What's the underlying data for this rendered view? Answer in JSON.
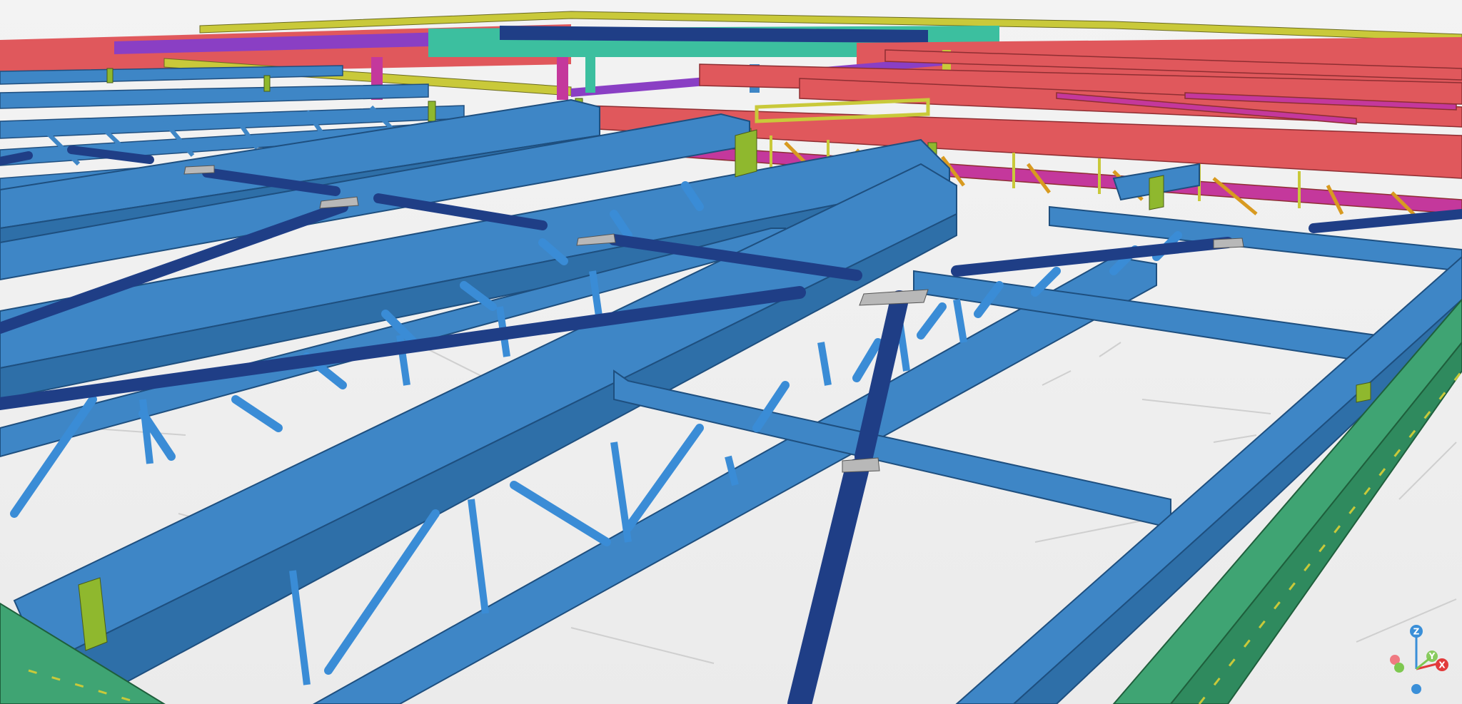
{
  "viewer": {
    "background": "#eeeeee",
    "axis_gizmo": {
      "z_label": "Z",
      "x_label": "X",
      "y_label": "Y",
      "colors": {
        "z": "#3a8fd8",
        "x": "#e23a3a",
        "y": "#7ec850",
        "neg_x": "#f07a82",
        "neg_y": "#7ec850",
        "neg_z": "#3a8fd8"
      }
    },
    "model_colors": {
      "framing_blue": "#3e86c6",
      "bracing_navy": "#1f3e86",
      "beam_red": "#e0585c",
      "beam_green": "#3fa473",
      "beam_teal": "#3cbf9f",
      "beam_yellow": "#c9c93a",
      "beam_purple": "#8a3fc4",
      "beam_magenta": "#c4389c",
      "connection_olive": "#8fb82e",
      "plate_grey": "#8a8a8a"
    }
  }
}
